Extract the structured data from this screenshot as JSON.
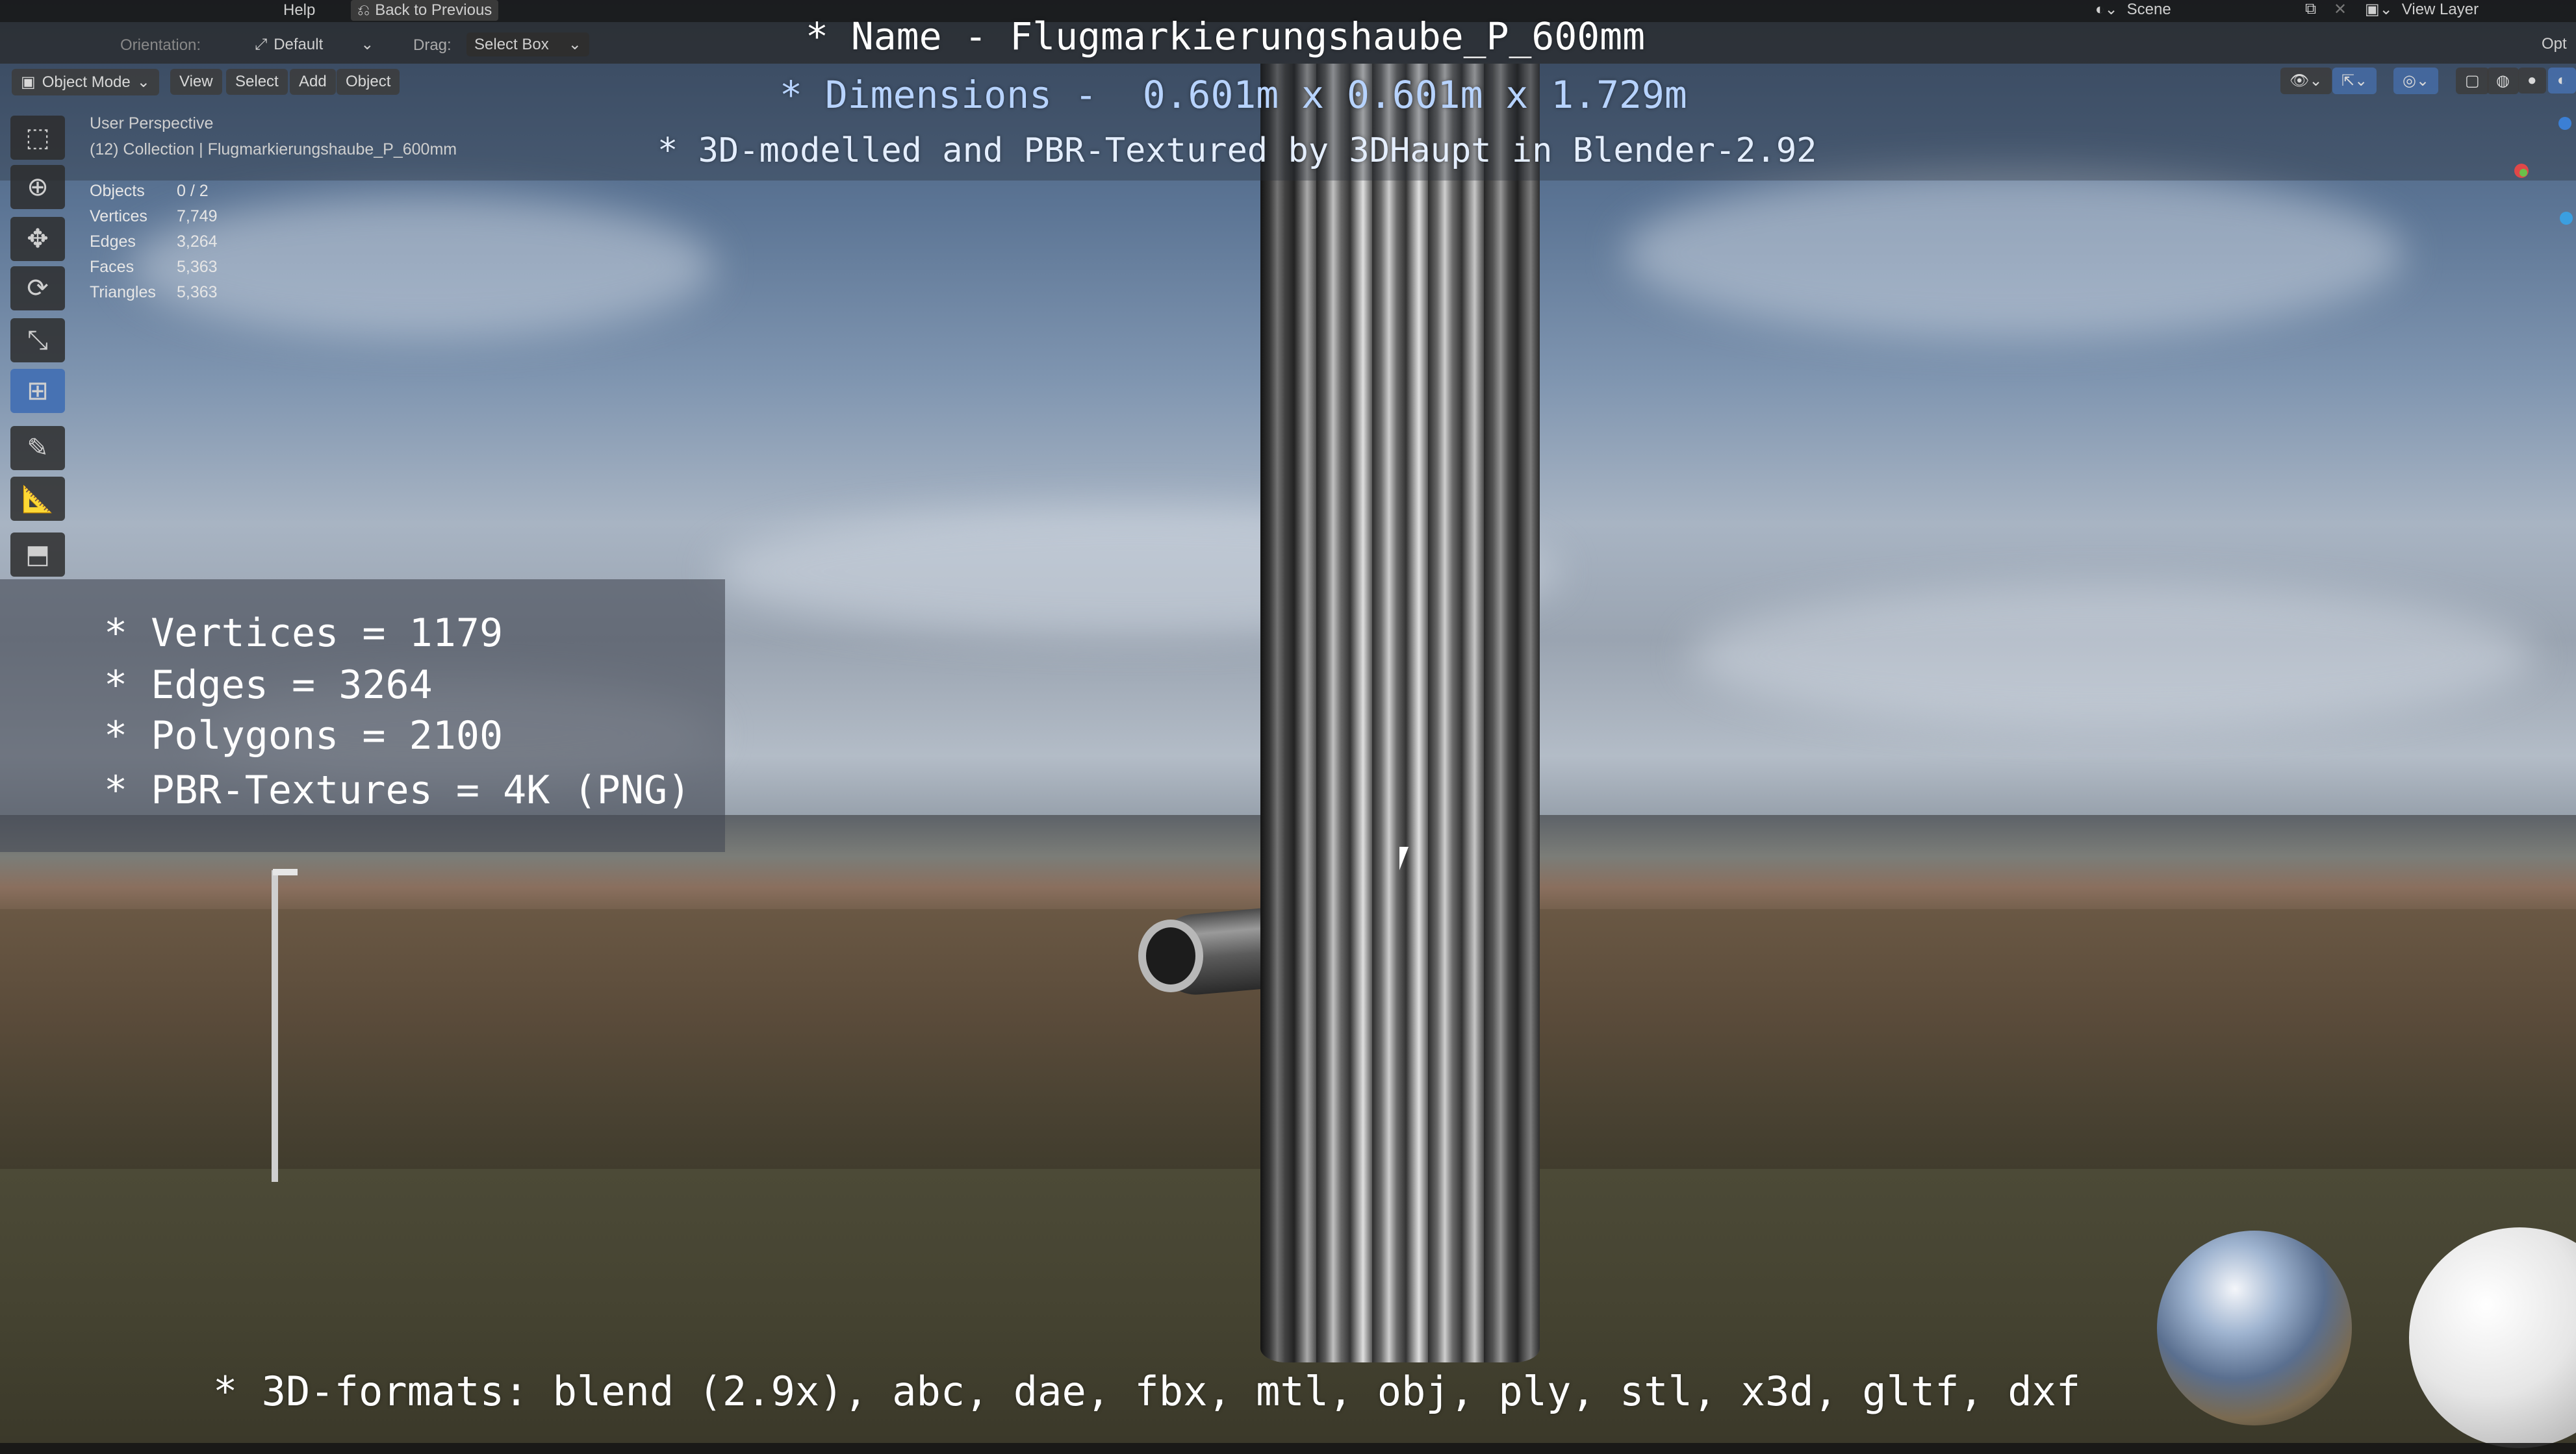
{
  "menu": {
    "help_label": "Help",
    "back_label": "Back to Previous",
    "orientation_label": "Orientation:",
    "default_label": "Default",
    "drag_label": "Drag:",
    "select_box_label": "Select Box",
    "scene_label": "Scene",
    "view_layer_label": "View Layer",
    "opt_label": "Opt"
  },
  "header": {
    "mode_label": "Object Mode",
    "view_label": "View",
    "select_label": "Select",
    "add_label": "Add",
    "object_label": "Object"
  },
  "viewport": {
    "perspective": "User Perspective",
    "collection": "(12) Collection | Flugmarkierungshaube_P_600mm",
    "stats": [
      {
        "label": "Objects",
        "value": "0 / 2"
      },
      {
        "label": "Vertices",
        "value": "7,749"
      },
      {
        "label": "Edges",
        "value": "3,264"
      },
      {
        "label": "Faces",
        "value": "5,363"
      },
      {
        "label": "Triangles",
        "value": "5,363"
      }
    ]
  },
  "overlay": {
    "name_line": "* Name - Flugmarkierungshaube_P_600mm",
    "dimensions_line": "* Dimensions -  0.601m x 0.601m x 1.729m",
    "credit_line": "* 3D-modelled and PBR-Textured by 3DHaupt in Blender-2.92",
    "vertices_line": "* Vertices = 1179",
    "edges_line": "* Edges = 3264",
    "polygons_line": "* Polygons = 2100",
    "textures_line": "* PBR-Textures = 4K (PNG)",
    "formats_line": "* 3D-formats: blend (2.9x), abc, dae, fbx, mtl, obj, ply, stl, x3d, gltf, dxf"
  },
  "colors": {
    "active_tool": "#4772b3",
    "overlay_text": "#ffffff",
    "overlay_highlight": "#b7d3ff"
  }
}
